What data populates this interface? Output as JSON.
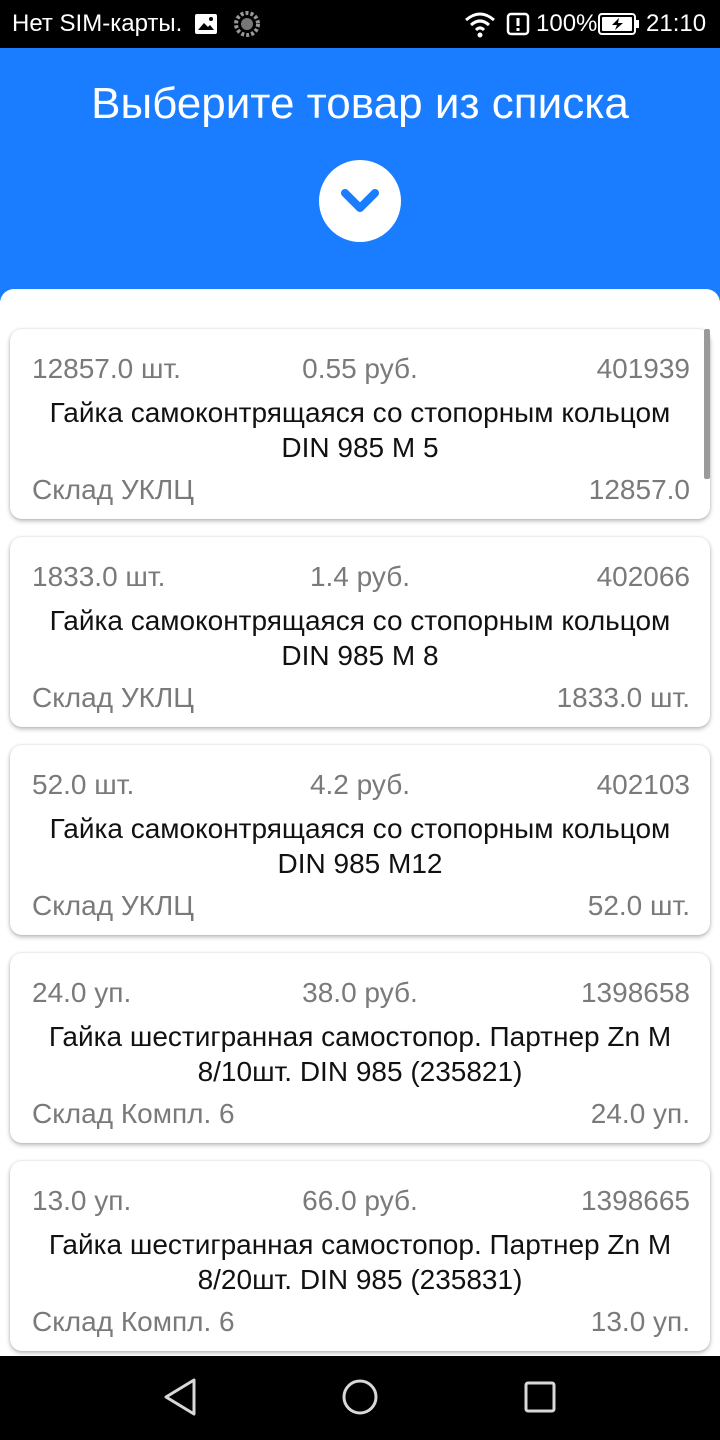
{
  "status_bar": {
    "carrier": "Нет SIM-карты.",
    "battery_percent": "100%",
    "time": "21:10"
  },
  "header": {
    "title": "Выберите товар из списка",
    "expand_icon": "chevron-down-icon",
    "background_color": "#1a7dff"
  },
  "items": [
    {
      "qty": "12857.0 шт.",
      "price": "0.55 руб.",
      "code": "401939",
      "name": "Гайка самоконтрящаяся со стопорным кольцом DIN 985 M 5",
      "warehouse": "Склад УКЛЦ",
      "stock": "12857.0"
    },
    {
      "qty": "1833.0 шт.",
      "price": "1.4 руб.",
      "code": "402066",
      "name": "Гайка самоконтрящаяся со стопорным кольцом DIN 985 M 8",
      "warehouse": "Склад УКЛЦ",
      "stock": "1833.0 шт."
    },
    {
      "qty": "52.0 шт.",
      "price": "4.2 руб.",
      "code": "402103",
      "name": "Гайка самоконтрящаяся со стопорным кольцом DIN 985 M12",
      "warehouse": "Склад УКЛЦ",
      "stock": "52.0 шт."
    },
    {
      "qty": "24.0 уп.",
      "price": "38.0 руб.",
      "code": "1398658",
      "name": "Гайка шестигранная самостопор. Партнер Zn M 8/10шт. DIN 985 (235821)",
      "warehouse": "Склад Компл. 6",
      "stock": "24.0 уп."
    },
    {
      "qty": "13.0 уп.",
      "price": "66.0 руб.",
      "code": "1398665",
      "name": "Гайка шестигранная самостопор. Партнер Zn M 8/20шт. DIN 985 (235831)",
      "warehouse": "Склад Компл. 6",
      "stock": "13.0 уп."
    }
  ],
  "nav_bar": {
    "back_icon": "back-triangle-icon",
    "home_icon": "home-circle-icon",
    "recents_icon": "recents-square-icon"
  }
}
